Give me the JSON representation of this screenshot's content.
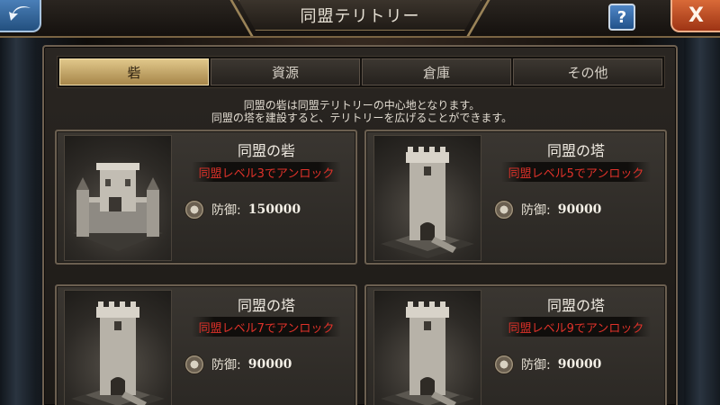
{
  "window": {
    "title": "同盟テリトリー"
  },
  "buttons": {
    "help_label": "?",
    "close_label": "X"
  },
  "tabs": [
    {
      "label": "砦",
      "active": true
    },
    {
      "label": "資源",
      "active": false
    },
    {
      "label": "倉庫",
      "active": false
    },
    {
      "label": "その他",
      "active": false
    }
  ],
  "description": {
    "line1": "同盟の砦は同盟テリトリーの中心地となります。",
    "line2": "同盟の塔を建設すると、テリトリーを広げることができます。"
  },
  "cards": [
    {
      "name": "同盟の砦",
      "unlock": "同盟レベル3でアンロック",
      "defense_label": "防御:",
      "defense_value": "150000",
      "icon": "fortress-icon"
    },
    {
      "name": "同盟の塔",
      "unlock": "同盟レベル5でアンロック",
      "defense_label": "防御:",
      "defense_value": "90000",
      "icon": "tower-icon"
    },
    {
      "name": "同盟の塔",
      "unlock": "同盟レベル7でアンロック",
      "defense_label": "防御:",
      "defense_value": "90000",
      "icon": "tower-icon"
    },
    {
      "name": "同盟の塔",
      "unlock": "同盟レベル9でアンロック",
      "defense_label": "防御:",
      "defense_value": "90000",
      "icon": "tower-icon"
    }
  ],
  "colors": {
    "accent_gold": "#d8bd7e",
    "unlock_red": "#e0322a",
    "close_orange": "#d96a38",
    "help_blue": "#4f86c6"
  }
}
